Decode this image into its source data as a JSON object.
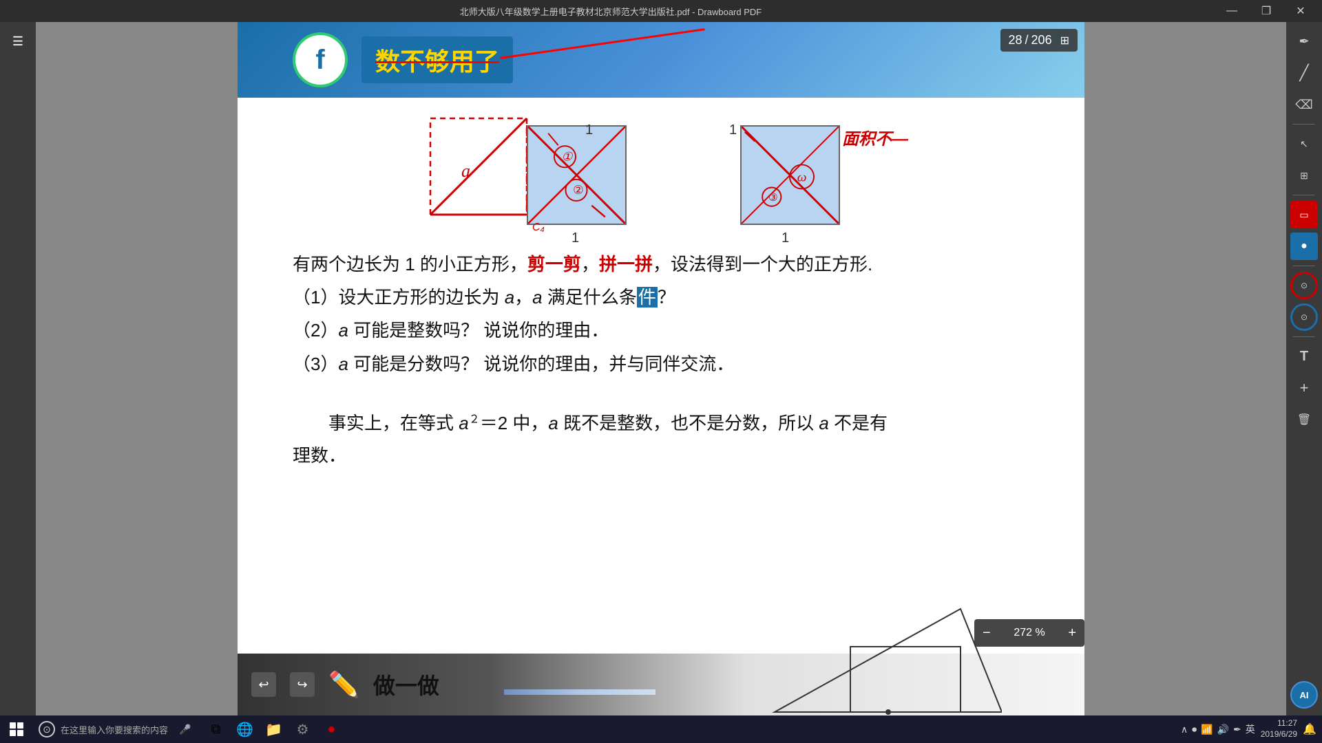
{
  "titlebar": {
    "title": "北师大版八年级数学上册电子教材北京师范大学出版社.pdf - Drawboard PDF",
    "minimize": "—",
    "maximize": "❐",
    "close": "✕"
  },
  "header": {
    "logo_text": "f",
    "main_text": "数不够用了",
    "page_current": "28",
    "page_total": "206"
  },
  "diagrams": {
    "label_a": "a",
    "label_1_left_top": "1",
    "label_1_left_bottom": "1",
    "label_1_right_top": "1",
    "label_1_right_bottom": "1",
    "red_annotation": "面积不—"
  },
  "text_content": {
    "line1": "有两个边长为 1 的小正方形，剪一剪，拼一拼，设法得到一个大的正方形.",
    "line1_highlight1": "剪一剪",
    "line1_highlight2": "拼一拼",
    "line2": "（1）设大正方形的边长为 a，a 满足什么条件？",
    "line3": "（2）a 可能是整数吗？ 说说你的理由．",
    "line4": "（3）a 可能是分数吗？ 说说你的理由，并与同伴交流．"
  },
  "fact_section": {
    "text": "事实上，在等式 a² = 2 中，a 既不是整数，也不是分数，所以 a 不是有理数．"
  },
  "do_section": {
    "title": "做一做"
  },
  "zoom": {
    "value": "272 %",
    "minus": "−",
    "plus": "+"
  },
  "taskbar": {
    "search_placeholder": "在这里输入你要搜索的内容",
    "time": "11:27",
    "date": "2019/6/29",
    "lang": "英",
    "ai_label": "Ai"
  },
  "right_sidebar_tools": [
    {
      "name": "pen-tool",
      "icon": "✏",
      "active": false
    },
    {
      "name": "highlighter-tool",
      "icon": "/",
      "active": false
    },
    {
      "name": "eraser-tool",
      "icon": "⌫",
      "active": false
    },
    {
      "name": "arrow-tool",
      "icon": "↖",
      "active": false
    },
    {
      "name": "crop-tool",
      "icon": "⊞",
      "active": false
    },
    {
      "name": "shape-red-tool",
      "icon": "▭",
      "active": false,
      "color": "red"
    },
    {
      "name": "shape-circle-tool",
      "icon": "○",
      "active": false,
      "color": "blue"
    },
    {
      "name": "text-tool",
      "icon": "T",
      "active": false
    },
    {
      "name": "add-tool",
      "icon": "+",
      "active": false
    },
    {
      "name": "delete-tool",
      "icon": "🗑",
      "active": false
    }
  ]
}
